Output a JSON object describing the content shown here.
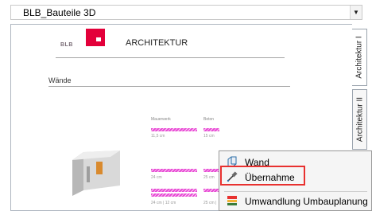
{
  "dropdown": {
    "value": "BLB_Bauteile 3D"
  },
  "document": {
    "logo_text": "BLB",
    "title": "ARCHITEKTUR",
    "section": "Wände",
    "columns": [
      "Mauerwerk",
      "Beton"
    ],
    "hatch_rows": [
      {
        "left": "11,5 cm",
        "right": "15 cm"
      },
      {
        "left": "24 cm",
        "right": "25 cm"
      },
      {
        "left": "24 cm | 12 cm",
        "right": "25 cm |"
      }
    ]
  },
  "tabs": [
    {
      "label": "Architektur I"
    },
    {
      "label": "Architektur II"
    }
  ],
  "context_menu": {
    "items": [
      {
        "label": "Wand",
        "icon": "wall-icon"
      },
      {
        "label": "Übernahme",
        "icon": "eyedropper-icon"
      },
      {
        "label": "Umwandlung Umbauplanung",
        "icon": "conversion-icon"
      }
    ],
    "highlight_color": "#e8312f"
  },
  "colors": {
    "brand": "#e3003a",
    "hatch": "#e84bd5"
  }
}
